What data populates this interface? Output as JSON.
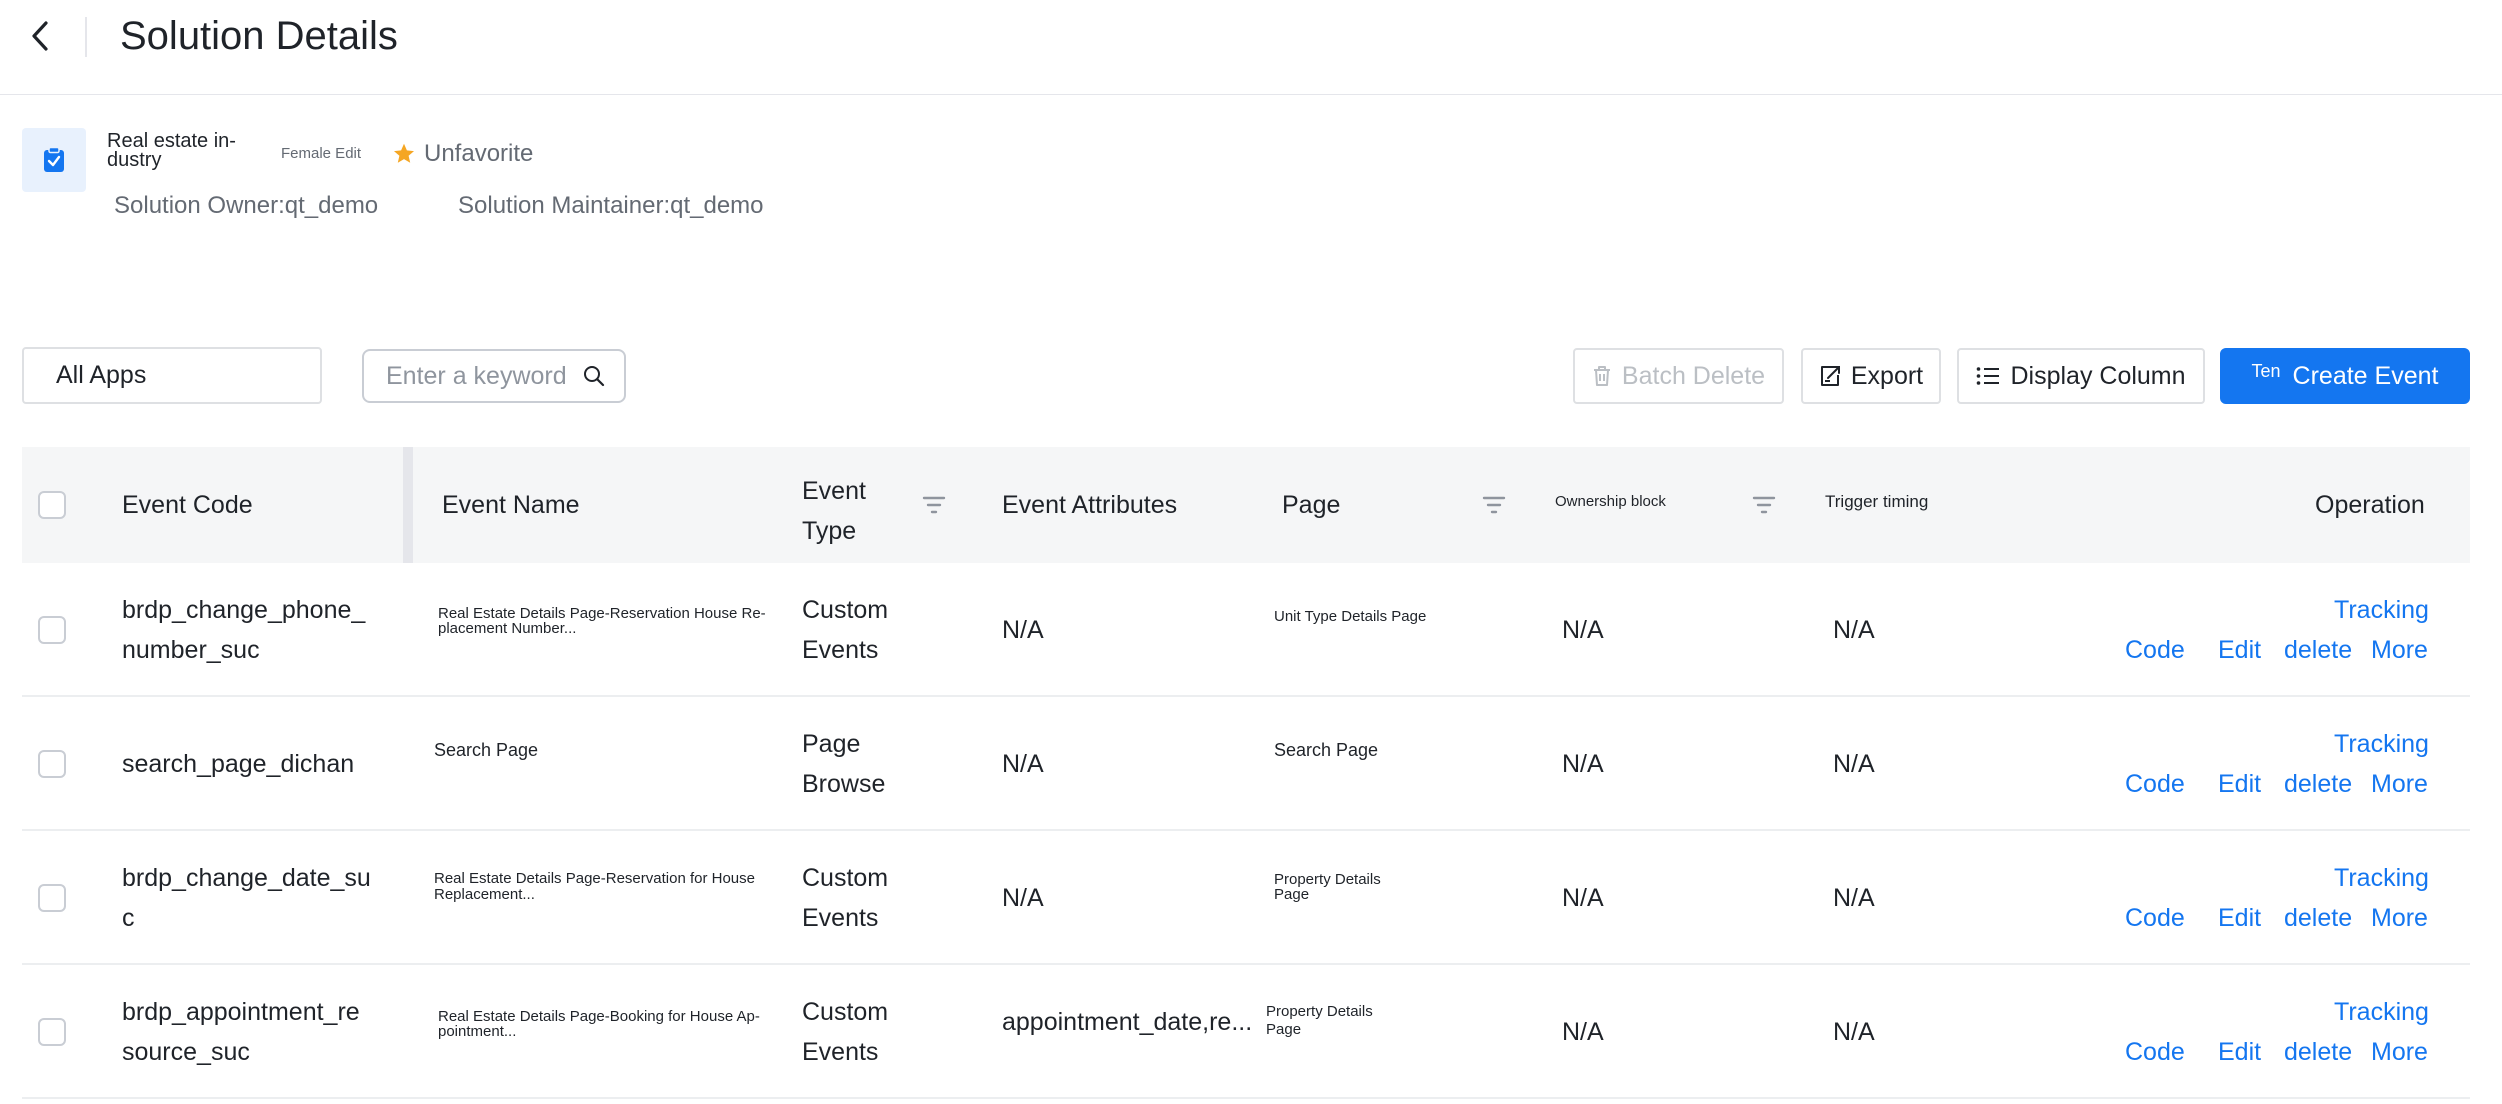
{
  "header": {
    "title": "Solution Details"
  },
  "solution": {
    "name": "Real estate in-dustry",
    "tag": "Female Edit",
    "favorite_label": "Unfavorite",
    "owner": "Solution Owner:qt_demo",
    "maintainer": "Solution Maintainer:qt_demo"
  },
  "toolbar": {
    "app_select": "All Apps",
    "search_placeholder": "Enter a keyword",
    "batch_delete": "Batch Delete",
    "export": "Export",
    "display_column": "Display Column",
    "create_prefix": "Ten",
    "create_event": "Create Event"
  },
  "table": {
    "columns": {
      "event_code": "Event Code",
      "event_name": "Event Name",
      "event_type": "Event Type",
      "event_attributes": "Event Attributes",
      "page": "Page",
      "ownership_block": "Ownership block",
      "trigger_timing": "Trigger timing",
      "operation": "Operation"
    },
    "ops": {
      "tracking": "Tracking",
      "code": "Code",
      "edit": "Edit",
      "delete": "delete",
      "more": "More"
    },
    "rows": [
      {
        "code_line1": "brdp_change_phone_",
        "code_line2": "number_suc",
        "name_line1": "Real Estate Details Page-Reservation House Re-",
        "name_line2": "placement Number...",
        "type_line1": "Custom",
        "type_line2": "Events",
        "attributes": "N/A",
        "page_line1": "Unit Type Details Page",
        "page_line2": "",
        "ownership": "N/A",
        "trigger": "N/A"
      },
      {
        "code_line1": "search_page_dichan",
        "code_line2": "",
        "name_line1": "Search Page",
        "name_line2": "",
        "type_line1": "Page",
        "type_line2": "Browse",
        "attributes": "N/A",
        "page_line1": "Search Page",
        "page_line2": "",
        "ownership": "N/A",
        "trigger": "N/A"
      },
      {
        "code_line1": "brdp_change_date_su",
        "code_line2": "c",
        "name_line1": "Real Estate Details Page-Reservation for House",
        "name_line2": "Replacement...",
        "type_line1": "Custom",
        "type_line2": "Events",
        "attributes": "N/A",
        "page_line1": "Property Details",
        "page_line2": "Page",
        "ownership": "N/A",
        "trigger": "N/A"
      },
      {
        "code_line1": "brdp_appointment_re",
        "code_line2": "source_suc",
        "name_line1": "Real Estate Details Page-Booking for House Ap-",
        "name_line2": "pointment...",
        "type_line1": "Custom",
        "type_line2": "Events",
        "attributes": "appointment_date,re...",
        "page_line1": "Property Details",
        "page_line2": "Page",
        "ownership": "N/A",
        "trigger": "N/A"
      }
    ]
  },
  "colors": {
    "accent": "#1476f0",
    "star": "#f5a623",
    "muted": "#646a73"
  }
}
